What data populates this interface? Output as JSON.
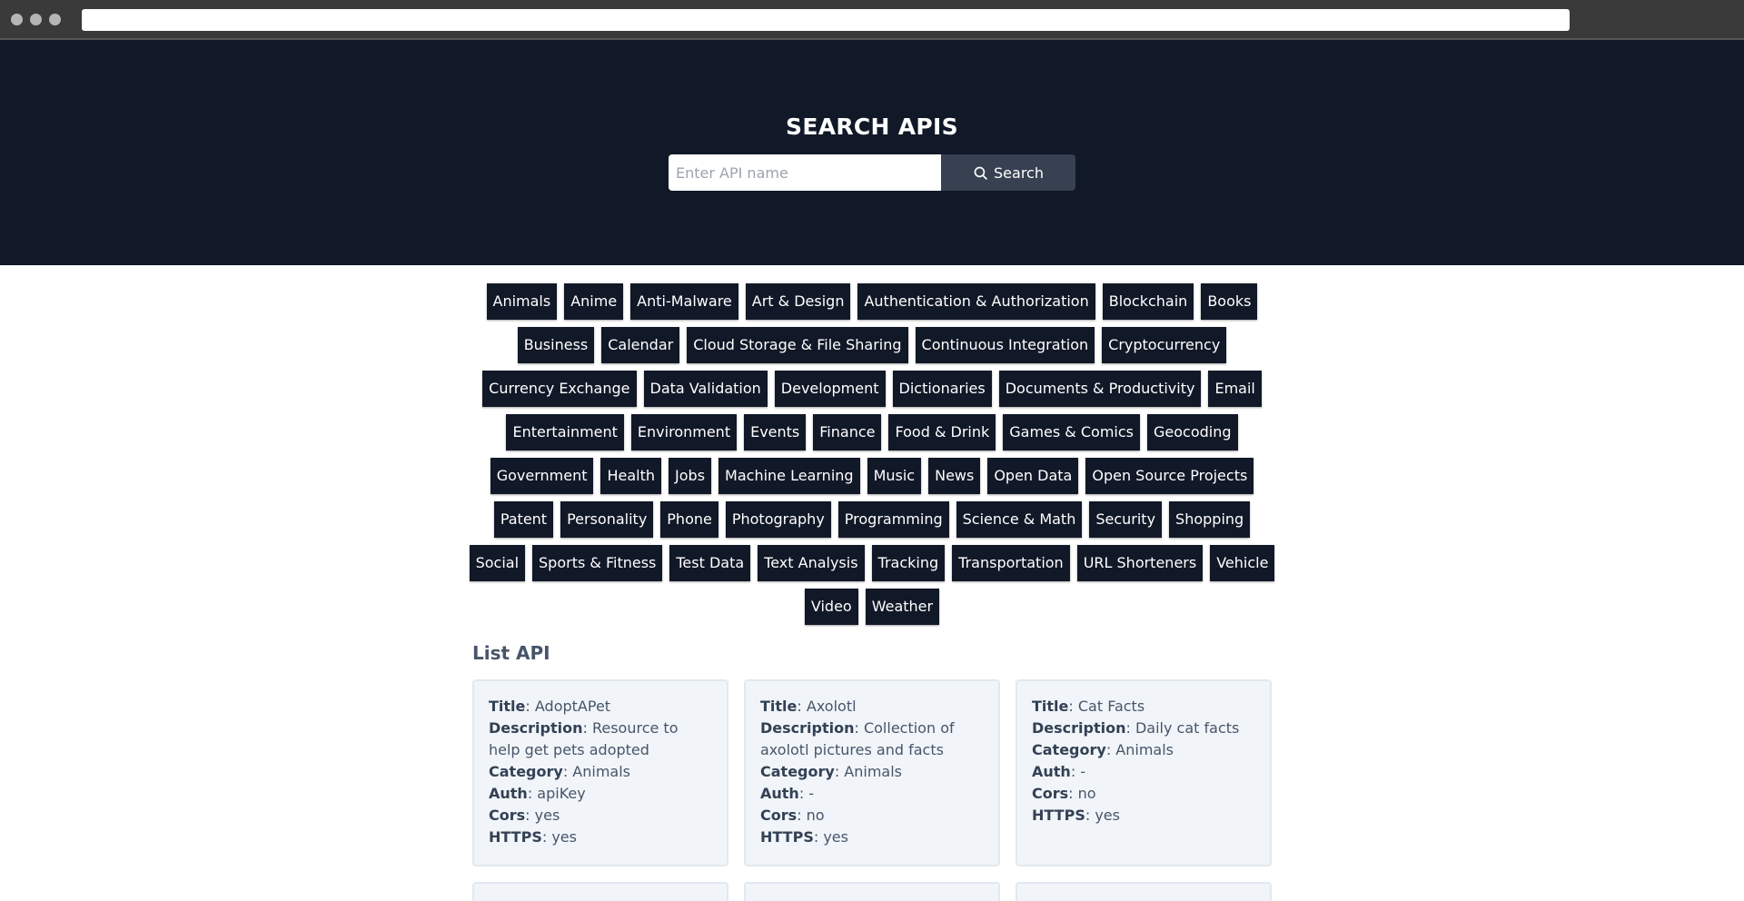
{
  "hero": {
    "title": "SEARCH APIS",
    "search_placeholder": "Enter API name",
    "search_value": "",
    "search_button": "Search",
    "search_icon": "magnifier-icon"
  },
  "categories": [
    "Animals",
    "Anime",
    "Anti-Malware",
    "Art & Design",
    "Authentication & Authorization",
    "Blockchain",
    "Books",
    "Business",
    "Calendar",
    "Cloud Storage & File Sharing",
    "Continuous Integration",
    "Cryptocurrency",
    "Currency Exchange",
    "Data Validation",
    "Development",
    "Dictionaries",
    "Documents & Productivity",
    "Email",
    "Entertainment",
    "Environment",
    "Events",
    "Finance",
    "Food & Drink",
    "Games & Comics",
    "Geocoding",
    "Government",
    "Health",
    "Jobs",
    "Machine Learning",
    "Music",
    "News",
    "Open Data",
    "Open Source Projects",
    "Patent",
    "Personality",
    "Phone",
    "Photography",
    "Programming",
    "Science & Math",
    "Security",
    "Shopping",
    "Social",
    "Sports & Fitness",
    "Test Data",
    "Text Analysis",
    "Tracking",
    "Transportation",
    "URL Shorteners",
    "Vehicle",
    "Video",
    "Weather"
  ],
  "list": {
    "heading": "List API",
    "labels": {
      "title": "Title",
      "description": "Description",
      "category": "Category",
      "auth": "Auth",
      "cors": "Cors",
      "https": "HTTPS"
    },
    "items": [
      {
        "title": "AdoptAPet",
        "description": "Resource to help get pets adopted",
        "category": "Animals",
        "auth": "apiKey",
        "cors": "yes",
        "https": "yes"
      },
      {
        "title": "Axolotl",
        "description": "Collection of axolotl pictures and facts",
        "category": "Animals",
        "auth": "-",
        "cors": "no",
        "https": "yes"
      },
      {
        "title": "Cat Facts",
        "description": "Daily cat facts",
        "category": "Animals",
        "auth": "-",
        "cors": "no",
        "https": "yes"
      }
    ]
  },
  "colors": {
    "hero_bg": "#111827",
    "chip_bg": "#111827",
    "search_button_bg": "#374151",
    "card_bg": "#f1f5f9"
  }
}
